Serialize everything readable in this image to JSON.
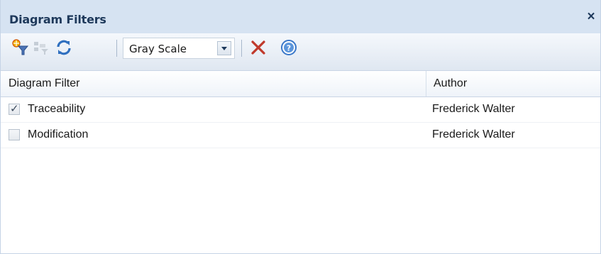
{
  "panel": {
    "title": "Diagram Filters",
    "close_symbol": "×"
  },
  "toolbar": {
    "buttons": [
      {
        "icon": "new-filter-icon"
      },
      {
        "icon": "filter-properties-icon",
        "disabled": true
      },
      {
        "icon": "refresh-icon"
      }
    ],
    "color_mode": {
      "selected": "Gray Scale"
    },
    "delete_icon": "delete-icon",
    "help_icon": "help-icon"
  },
  "table": {
    "columns": [
      "Diagram Filter",
      "Author"
    ],
    "rows": [
      {
        "name": "Traceability",
        "author": "Frederick Walter",
        "checked": true
      },
      {
        "name": "Modification",
        "author": "Frederick Walter",
        "checked": false
      }
    ]
  },
  "colors": {
    "title_bg": "#d6e3f2",
    "title_text": "#1e395b",
    "delete_red": "#c0392b",
    "help_blue": "#3a78c9"
  }
}
